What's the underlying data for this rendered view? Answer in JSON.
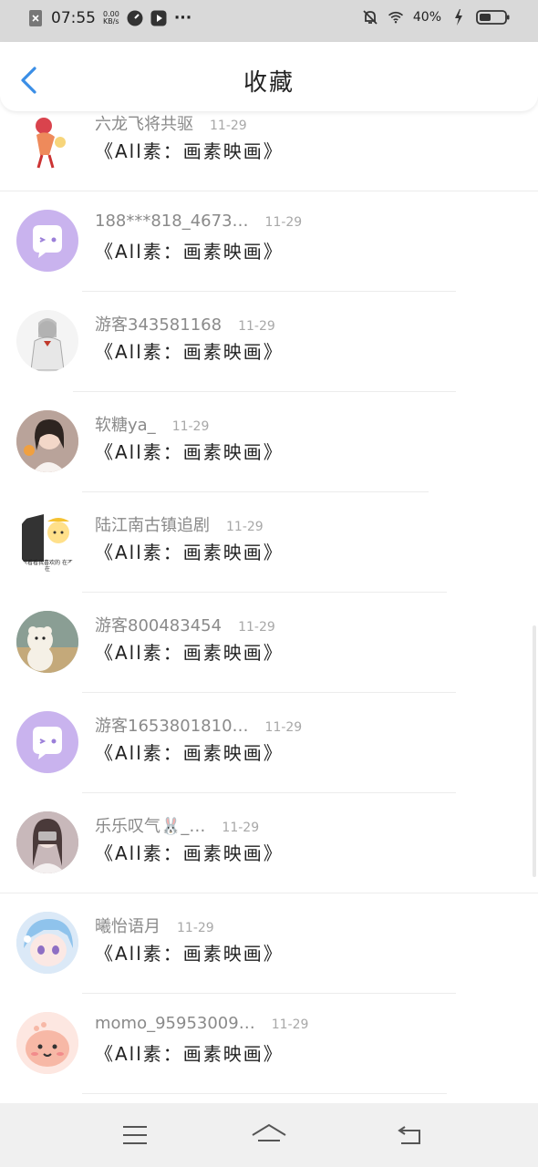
{
  "status_bar": {
    "time": "07:55",
    "speed_value": "0.00",
    "speed_unit": "KB/s",
    "more": "···",
    "battery": "40%"
  },
  "header": {
    "title": "收藏"
  },
  "items": [
    {
      "name": "六龙飞将共驱",
      "date": "11-29",
      "title": "《All素：画素映画》"
    },
    {
      "name": "188***818_4673…",
      "date": "11-29",
      "title": "《All素：画素映画》"
    },
    {
      "name": "游客343581168",
      "date": "11-29",
      "title": "《All素：画素映画》"
    },
    {
      "name": "软糖ya_",
      "date": "11-29",
      "title": "《All素：画素映画》"
    },
    {
      "name": "陆江南古镇追剧",
      "date": "11-29",
      "title": "《All素：画素映画》"
    },
    {
      "name": "游客800483454",
      "date": "11-29",
      "title": "《All素：画素映画》"
    },
    {
      "name": "游客1653801810…",
      "date": "11-29",
      "title": "《All素：画素映画》"
    },
    {
      "name": "乐乐叹气🐰_…",
      "date": "11-29",
      "title": "《All素：画素映画》"
    },
    {
      "name": "曦怡语月",
      "date": "11-29",
      "title": "《All素：画素映画》"
    },
    {
      "name": "momo_95953009…",
      "date": "11-29",
      "title": "《All素：画素映画》"
    }
  ],
  "avatar_overlay_text": "就看看我喜欢的 在不在",
  "colors": {
    "accent": "#3a8ee6",
    "default_avatar_bg": "#c9b3ee",
    "status_bar_bg": "#d9d9d9",
    "navbar_bg": "#f0f0f0"
  },
  "icons": [
    "back-arrow-icon",
    "menu-icon",
    "home-icon",
    "back-icon"
  ]
}
